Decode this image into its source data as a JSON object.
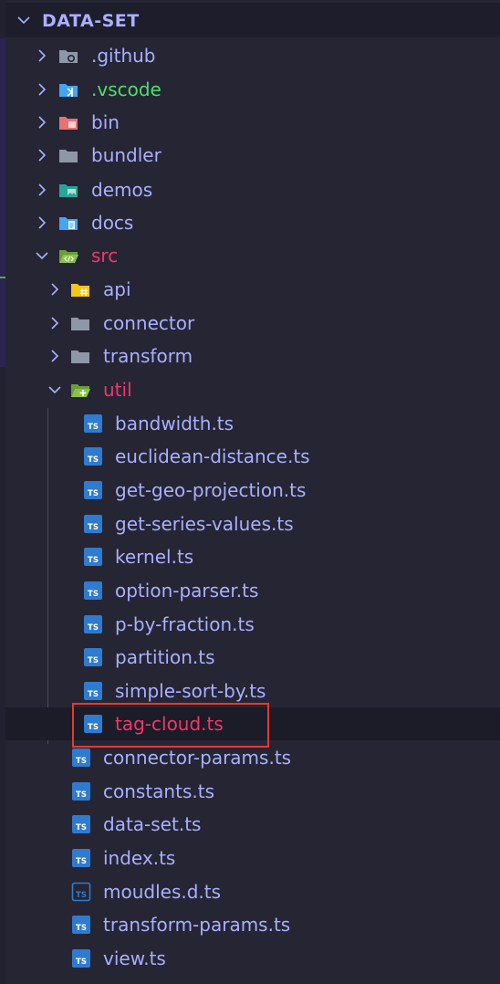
{
  "explorer": {
    "title": "DATA-SET"
  },
  "tree": {
    "github": ".github",
    "vscode": ".vscode",
    "bin": "bin",
    "bundler": "bundler",
    "demos": "demos",
    "docs": "docs",
    "src": "src",
    "api": "api",
    "connector": "connector",
    "transform": "transform",
    "util": "util",
    "bandwidth": "bandwidth.ts",
    "euclidean": "euclidean-distance.ts",
    "geo": "get-geo-projection.ts",
    "series": "get-series-values.ts",
    "kernel": "kernel.ts",
    "option_parser": "option-parser.ts",
    "p_by_fraction": "p-by-fraction.ts",
    "partition": "partition.ts",
    "simple_sort": "simple-sort-by.ts",
    "tag_cloud": "tag-cloud.ts",
    "connector_params": "connector-params.ts",
    "constants": "constants.ts",
    "data_set": "data-set.ts",
    "index": "index.ts",
    "moudles": "moudles.d.ts",
    "transform_params": "transform-params.ts",
    "view": "view.ts"
  },
  "icons": {
    "ts_badge": "TS",
    "colors": {
      "folder_grey": "#8e97a6",
      "folder_green": "#7cb342",
      "folder_yellow": "#f5c518",
      "folder_red": "#e57373",
      "folder_blue": "#42a5f5",
      "folder_teal": "#26a69a",
      "ts_blue": "#2f7bcf"
    }
  }
}
